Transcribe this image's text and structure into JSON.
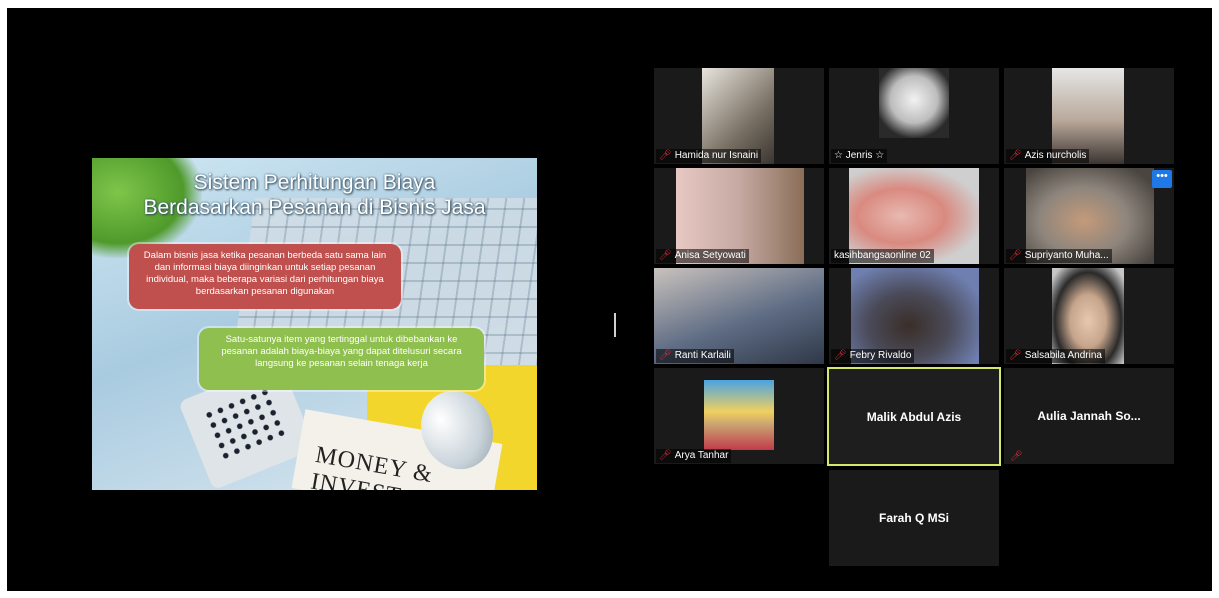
{
  "slide": {
    "title_line1": "Sistem Perhitungan Biaya",
    "title_line2": "Berdasarkan Pesanan di Bisnis Jasa",
    "red_box": "Dalam bisnis jasa ketika pesanan berbeda satu sama lain dan informasi biaya diinginkan untuk setiap pesanan individual, maka beberapa variasi dari perhitungan biaya berdasarkan pesanan digunakan",
    "green_box": "Satu-satunya item yang tertinggal untuk dibebankan ke pesanan adalah biaya-biaya yang dapat ditelusuri secara langsung ke pesanan selain tenaga kerja",
    "newspaper_text": "MONEY & INVEST"
  },
  "participants": [
    {
      "name": "Hamida nur Isnaini",
      "muted": true,
      "video_color": "#7a7266"
    },
    {
      "name": "☆ Jenris ☆",
      "muted": false,
      "video_color": "#d9d9d9"
    },
    {
      "name": "Azis nurcholis",
      "muted": true,
      "video_color": "#b8a89a"
    },
    {
      "name": "Anisa Setyowati",
      "muted": true,
      "video_color": "#c5a9a2"
    },
    {
      "name": "kasihbangsaonline 02",
      "muted": false,
      "video_color": "#e8b9b0"
    },
    {
      "name": "Supriyanto Muha...",
      "muted": true,
      "video_color": "#8d857c"
    },
    {
      "name": "Ranti Karlaili",
      "muted": true,
      "video_color": "#5e6c84"
    },
    {
      "name": "Febry Rivaldo",
      "muted": true,
      "video_color": "#6f7fb0"
    },
    {
      "name": "Salsabila Andrina",
      "muted": true,
      "video_color": "#c6c6c6"
    },
    {
      "name": "Arya Tanhar",
      "muted": true,
      "video_color": "#c8a070"
    },
    {
      "name": "Malik Abdul Azis",
      "muted": false,
      "active_speaker": true
    },
    {
      "name": "Aulia Jannah So...",
      "muted": true
    },
    {
      "name": "Farah Q MSi",
      "muted": false
    }
  ],
  "colors": {
    "background": "#000000",
    "tile": "#1a1a1a",
    "active_border": "#d2ea6a",
    "muted_mic": "#e0313a"
  }
}
